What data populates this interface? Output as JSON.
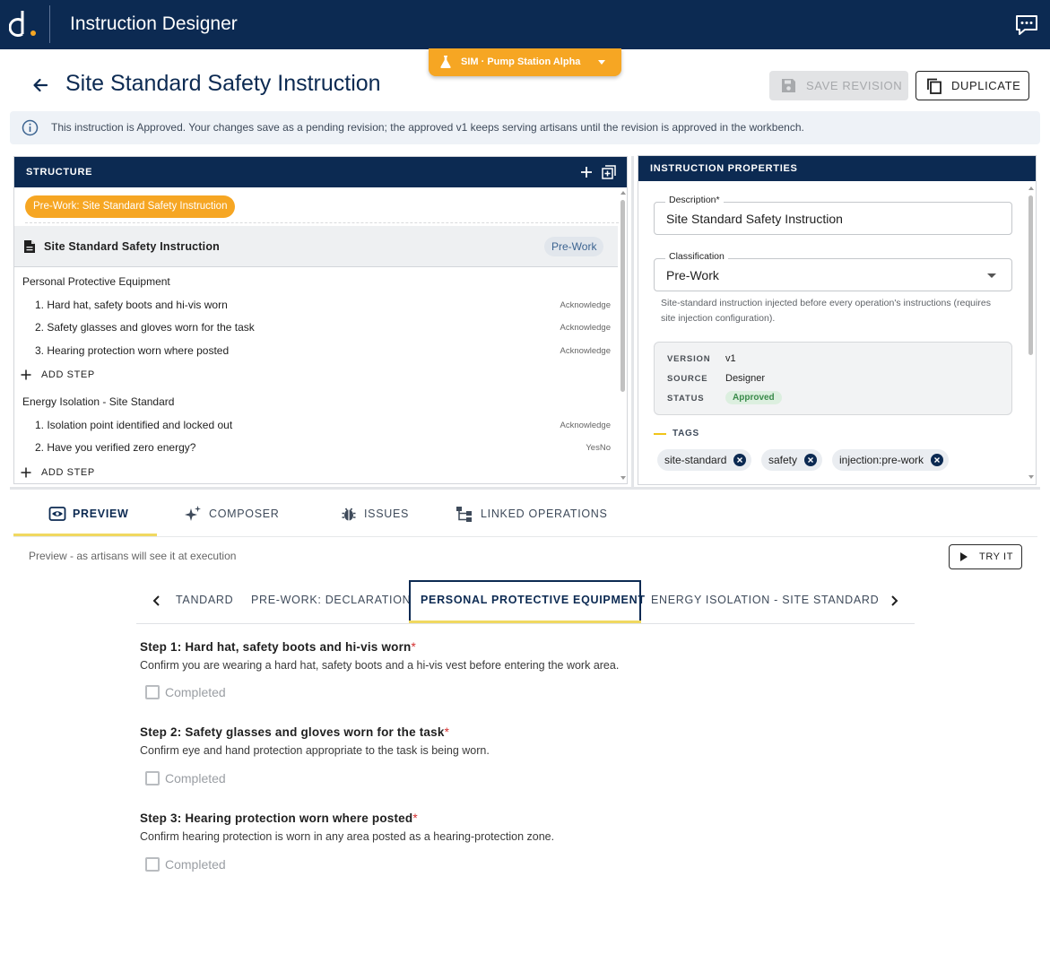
{
  "app": {
    "title": "Instruction Designer",
    "colors": {
      "navy": "#0c2a52",
      "accent": "#f6a623",
      "highlight": "#f0d860"
    }
  },
  "sim_badge": {
    "label": "SIM · Pump Station Alpha",
    "icon": "flask-icon"
  },
  "header": {
    "title": "Site Standard Safety Instruction",
    "save_label": "SAVE REVISION",
    "duplicate_label": "DUPLICATE"
  },
  "banner": {
    "text": "This instruction is Approved. Your changes save as a pending revision; the approved v1 keeps serving artisans until the revision is approved in the workbench."
  },
  "structure": {
    "title": "STRUCTURE",
    "breadcrumb": "Pre-Work: Site Standard Safety Instruction",
    "instruction": {
      "name": "Site Standard Safety Instruction",
      "classification": "Pre-Work"
    },
    "add_step_label": "ADD STEP",
    "groups": [
      {
        "name": "Personal Protective Equipment",
        "steps": [
          {
            "text": "1. Hard hat, safety boots and hi-vis worn",
            "type": "Acknowledge"
          },
          {
            "text": "2. Safety glasses and gloves worn for the task",
            "type": "Acknowledge"
          },
          {
            "text": "3. Hearing protection worn where posted",
            "type": "Acknowledge"
          }
        ]
      },
      {
        "name": "Energy Isolation - Site Standard",
        "steps": [
          {
            "text": "1. Isolation point identified and locked out",
            "type": "Acknowledge"
          },
          {
            "text": "2. Have you verified zero energy?",
            "type": "YesNo"
          }
        ]
      }
    ]
  },
  "properties": {
    "title": "INSTRUCTION PROPERTIES",
    "description_label": "Description*",
    "description_value": "Site Standard Safety Instruction",
    "classification_label": "Classification",
    "classification_value": "Pre-Work",
    "help_text": "Site-standard instruction injected before every operation's instructions (requires site injection configuration).",
    "meta": {
      "version_label": "VERSION",
      "version": "v1",
      "source_label": "SOURCE",
      "source": "Designer",
      "status_label": "STATUS",
      "status": "Approved"
    },
    "tags_label": "TAGS",
    "tags": [
      "site-standard",
      "safety",
      "injection:pre-work"
    ]
  },
  "bottom_tabs": [
    {
      "label": "PREVIEW",
      "icon": "eye-icon",
      "active": true
    },
    {
      "label": "COMPOSER",
      "icon": "sparkle-icon",
      "active": false
    },
    {
      "label": "ISSUES",
      "icon": "bug-icon",
      "active": false
    },
    {
      "label": "LINKED OPERATIONS",
      "icon": "hierarchy-icon",
      "active": false
    }
  ],
  "preview": {
    "caption": "Preview - as artisans will see it at execution",
    "try_label": "TRY IT",
    "section_tabs": [
      "TANDARD",
      "PRE-WORK: DECLARATION",
      "PERSONAL PROTECTIVE EQUIPMENT",
      "ENERGY ISOLATION - SITE STANDARD"
    ],
    "active_section": "PERSONAL PROTECTIVE EQUIPMENT",
    "completed_label": "Completed",
    "steps": [
      {
        "title": "Step 1: Hard hat, safety boots and hi-vis worn",
        "required": "*",
        "description": "Confirm you are wearing a hard hat, safety boots and a hi-vis vest before entering the work area."
      },
      {
        "title": "Step 2: Safety glasses and gloves worn for the task",
        "required": "*",
        "description": "Confirm eye and hand protection appropriate to the task is being worn."
      },
      {
        "title": "Step 3: Hearing protection worn where posted",
        "required": "*",
        "description": "Confirm hearing protection is worn in any area posted as a hearing-protection zone."
      }
    ]
  }
}
